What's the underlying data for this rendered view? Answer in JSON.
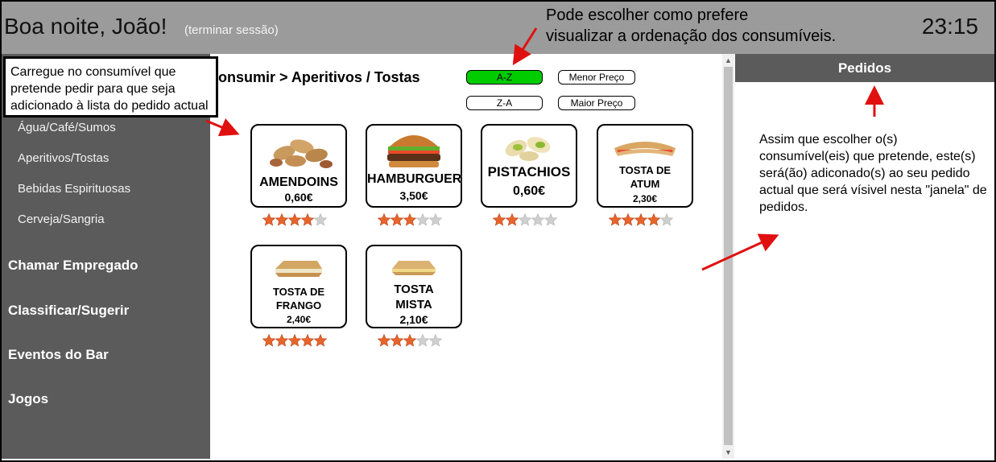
{
  "header": {
    "greeting": "Boa noite, João!",
    "logout_label": "(terminar sessão)",
    "clock": "23:15",
    "hint_line1": "Pode escolher como prefere",
    "hint_line2": "visualizar a ordenação dos consumíveis."
  },
  "sidebar": {
    "tooltip": "Carregue no consumível que pretende pedir para que seja adicionado à lista do pedido actual",
    "sub_items": [
      "Água/Café/Sumos",
      "Aperitivos/Tostas",
      "Bebidas Espirituosas",
      "Cerveja/Sangria"
    ],
    "main_items": [
      "Chamar Empregado",
      "Classificar/Sugerir",
      "Eventos do Bar",
      "Jogos"
    ]
  },
  "main": {
    "breadcrumb": "onsumir >  Aperitivos / Tostas",
    "sort": {
      "az": "A-Z",
      "za": "Z-A",
      "cheapest": "Menor Preço",
      "priciest": "Maior Preço",
      "active": "A-Z"
    },
    "products": [
      {
        "name": "AMENDOINS",
        "price": "0,60€",
        "rating": 4
      },
      {
        "name": "HAMBURGUER",
        "price": "3,50€",
        "rating": 3
      },
      {
        "name": "PISTACHIOS",
        "price": "0,60€",
        "rating": 2
      },
      {
        "name": "TOSTA DE ATUM",
        "price": "2,30€",
        "rating": 4
      },
      {
        "name": "TOSTA DE FRANGO",
        "price": "2,40€",
        "rating": 5
      },
      {
        "name": "TOSTA MISTA",
        "price": "2,10€",
        "rating": 3
      }
    ]
  },
  "orders": {
    "title": "Pedidos",
    "hint": "Assim que escolher o(s) consumível(eis) que pretende, este(s) será(ão) adiconado(s) ao seu pedido actual que será vísivel nesta \"janela\" de pedidos."
  },
  "colors": {
    "header_bg": "#9b9b9b",
    "sidebar_bg": "#5b5b5b",
    "active_sort": "#00cc00",
    "star_filled": "#e8642c",
    "star_empty": "#cfcfcf",
    "arrow": "#e01010"
  }
}
